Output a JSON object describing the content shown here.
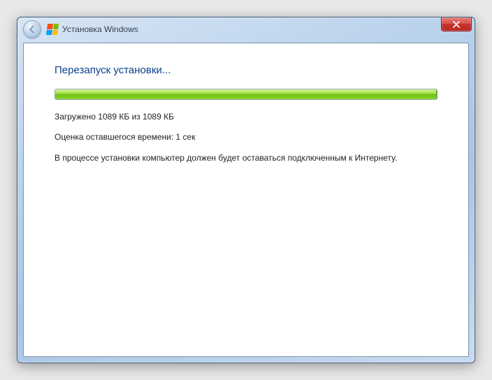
{
  "titlebar": {
    "title": "Установка Windows"
  },
  "content": {
    "heading": "Перезапуск установки...",
    "downloaded": "Загружено 1089 КБ из 1089 КБ",
    "estimate": "Оценка оставшегося времени: 1 сек",
    "note": "В процессе установки компьютер должен будет оставаться подключенным к Интернету."
  },
  "progress": {
    "percent": 100
  }
}
